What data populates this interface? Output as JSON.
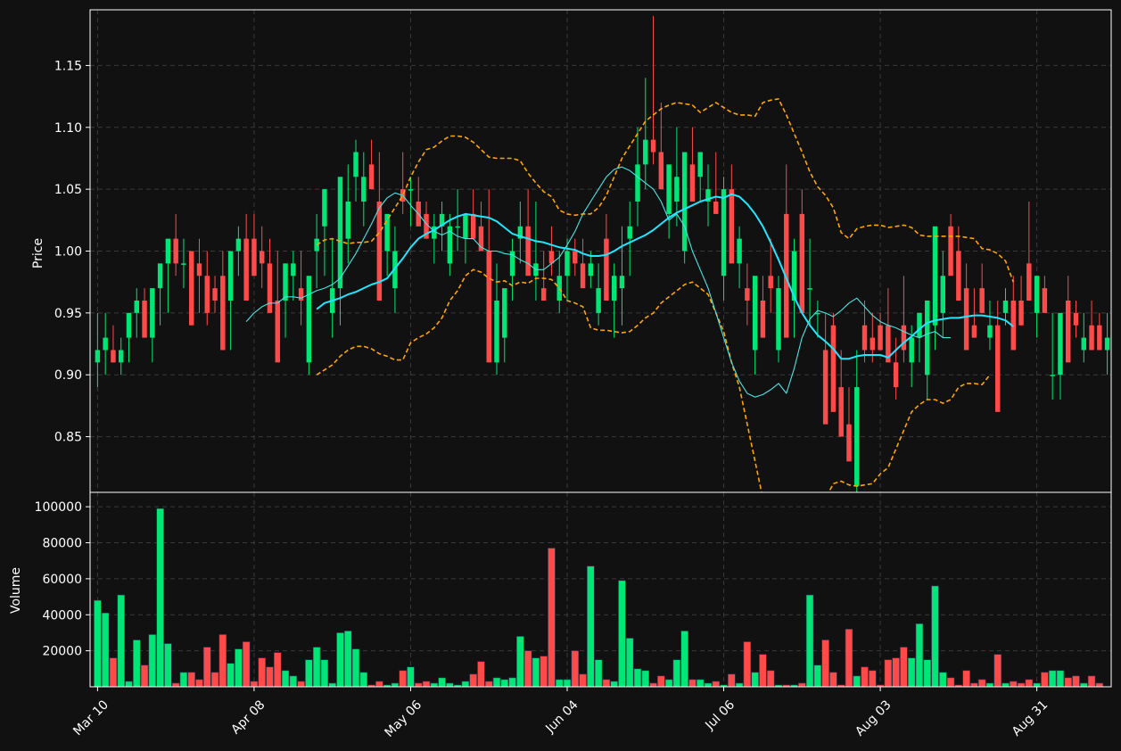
{
  "chart_data": [
    {
      "type": "candlestick",
      "title": "",
      "xlabel": "",
      "ylabel": "Price",
      "ylim": [
        0.805,
        1.195
      ],
      "y_ticks": [
        "0.85",
        "0.90",
        "0.95",
        "1.00",
        "1.05",
        "1.10",
        "1.15"
      ],
      "x_tick_labels": [
        "Mar 10",
        "Apr 08",
        "May 06",
        "Jun 04",
        "Jul 06",
        "Aug 03",
        "Aug 31"
      ],
      "x_tick_index": [
        0,
        20,
        40,
        60,
        80,
        100,
        120
      ],
      "grid": true,
      "colors": {
        "up": "#00e676",
        "down": "#ff4a4a",
        "ma_fast": "#4ce3e3",
        "ma_slow": "#22e5ff",
        "bollinger": "#ffa500",
        "grid": "#3a3a3a",
        "axis": "#ffffff",
        "background": "#111111"
      },
      "open": [
        0.91,
        0.92,
        0.92,
        0.91,
        0.93,
        0.95,
        0.96,
        0.93,
        0.97,
        0.99,
        1.01,
        0.99,
        1.0,
        0.99,
        0.98,
        0.97,
        0.98,
        0.96,
        1.0,
        1.01,
        1.01,
        1.0,
        0.99,
        0.96,
        0.96,
        0.98,
        0.97,
        0.91,
        1.0,
        1.02,
        0.95,
        0.97,
        1.01,
        1.06,
        1.04,
        1.07,
        1.04,
        1.0,
        0.97,
        1.05,
        1.05,
        1.04,
        1.03,
        1.01,
        1.02,
        0.99,
        1.02,
        1.01,
        1.03,
        1.02,
        1.0,
        0.91,
        0.93,
        0.98,
        1.01,
        1.02,
        0.98,
        0.97,
        1.0,
        0.96,
        0.98,
        1.0,
        0.99,
        0.98,
        0.95,
        1.01,
        0.96,
        0.97,
        1.01,
        1.04,
        1.07,
        1.09,
        1.08,
        1.03,
        1.04,
        1.0,
        1.07,
        1.06,
        1.04,
        1.04,
        0.98,
        1.05,
        0.99,
        0.97,
        0.92,
        0.96,
        0.98,
        0.92,
        1.03,
        0.96,
        1.03,
        0.97,
        0.95,
        0.92,
        0.94,
        0.89,
        0.86,
        0.81,
        0.94,
        0.93,
        0.94,
        0.94,
        0.91,
        0.94,
        0.91,
        0.93,
        0.9,
        0.94,
        0.95,
        1.02,
        1.0,
        0.97,
        0.94,
        0.97,
        0.93,
        0.94,
        0.95,
        0.96,
        0.96,
        0.99,
        0.95,
        0.97,
        0.9,
        0.9,
        0.96,
        0.95,
        0.92,
        0.94,
        0.94,
        0.92
      ],
      "high": [
        0.95,
        0.95,
        0.94,
        0.93,
        0.95,
        0.97,
        0.97,
        0.96,
        0.98,
        1.01,
        1.03,
        1.01,
        1.0,
        1.01,
        1.0,
        0.98,
        1.0,
        0.98,
        1.02,
        1.03,
        1.03,
        1.02,
        1.01,
        1.0,
        0.99,
        1.0,
        1.0,
        0.97,
        1.03,
        1.05,
        1.01,
        1.04,
        1.07,
        1.09,
        1.08,
        1.09,
        1.08,
        1.03,
        1.02,
        1.08,
        1.06,
        1.06,
        1.04,
        1.03,
        1.04,
        1.03,
        1.05,
        1.03,
        1.05,
        1.04,
        1.05,
        0.99,
        0.96,
        1.01,
        1.04,
        1.05,
        1.04,
        1.0,
        1.02,
        1.0,
        1.01,
        1.01,
        1.01,
        1.0,
        0.99,
        1.03,
        0.99,
        1.02,
        1.04,
        1.1,
        1.14,
        1.19,
        1.12,
        1.06,
        1.1,
        1.07,
        1.1,
        1.08,
        1.07,
        1.08,
        1.06,
        1.07,
        1.02,
        0.99,
        0.97,
        0.98,
        1.01,
        0.98,
        1.07,
        1.01,
        1.05,
        1.01,
        0.96,
        0.95,
        0.95,
        0.92,
        0.89,
        0.92,
        0.96,
        0.95,
        0.95,
        0.97,
        0.93,
        0.98,
        0.94,
        0.95,
        0.94,
        0.99,
        1.0,
        1.03,
        1.02,
        0.99,
        0.97,
        0.99,
        0.96,
        0.96,
        0.97,
        0.98,
        0.98,
        1.04,
        0.97,
        0.98,
        0.95,
        0.93,
        0.98,
        0.96,
        0.95,
        0.96,
        0.95,
        0.95
      ],
      "low": [
        0.89,
        0.9,
        0.91,
        0.9,
        0.91,
        0.93,
        0.94,
        0.91,
        0.94,
        0.95,
        0.98,
        0.97,
        0.98,
        0.95,
        0.94,
        0.95,
        0.95,
        0.92,
        0.98,
        0.99,
        0.99,
        0.97,
        0.95,
        0.94,
        0.93,
        0.96,
        0.94,
        0.9,
        0.97,
        0.98,
        0.93,
        0.94,
        0.99,
        1.04,
        1.02,
        1.05,
        1.01,
        0.98,
        0.95,
        1.03,
        1.02,
        1.02,
        1.01,
        0.99,
        1.0,
        0.98,
        1.0,
        0.99,
        1.01,
        1.0,
        0.98,
        0.9,
        0.91,
        0.96,
        0.99,
        1.0,
        0.96,
        0.96,
        0.98,
        0.95,
        0.96,
        0.98,
        0.97,
        0.97,
        0.94,
        0.99,
        0.93,
        0.94,
        0.98,
        1.02,
        1.05,
        1.07,
        1.05,
        1.01,
        1.02,
        0.99,
        1.04,
        1.04,
        1.02,
        1.03,
        0.96,
        1.03,
        0.97,
        0.94,
        0.9,
        0.93,
        0.95,
        0.91,
        1.0,
        0.93,
        1.0,
        0.94,
        0.93,
        0.91,
        0.92,
        0.86,
        0.85,
        0.8,
        0.91,
        0.91,
        0.92,
        0.92,
        0.88,
        0.91,
        0.89,
        0.91,
        0.88,
        0.92,
        0.93,
        0.99,
        0.98,
        0.95,
        0.93,
        0.95,
        0.92,
        0.92,
        0.94,
        0.94,
        0.94,
        0.96,
        0.93,
        0.95,
        0.88,
        0.88,
        0.94,
        0.93,
        0.91,
        0.92,
        0.92,
        0.9
      ],
      "close": [
        0.92,
        0.93,
        0.91,
        0.92,
        0.95,
        0.96,
        0.93,
        0.97,
        0.99,
        1.01,
        0.99,
        0.99,
        0.94,
        0.98,
        0.95,
        0.96,
        0.92,
        1.0,
        1.01,
        0.96,
        0.98,
        0.99,
        0.95,
        0.91,
        0.99,
        0.99,
        0.96,
        0.98,
        1.01,
        1.05,
        0.97,
        1.06,
        1.04,
        1.08,
        1.06,
        1.05,
        0.96,
        1.03,
        1.0,
        1.04,
        1.05,
        1.02,
        1.01,
        1.02,
        1.03,
        1.02,
        1.02,
        1.03,
        1.01,
        1.0,
        0.91,
        0.96,
        0.97,
        1.0,
        1.02,
        0.98,
        0.99,
        0.96,
        0.99,
        0.98,
        1.0,
        0.99,
        0.97,
        0.99,
        0.97,
        0.96,
        0.98,
        0.98,
        1.02,
        1.07,
        1.09,
        1.08,
        1.05,
        1.07,
        1.06,
        1.08,
        1.04,
        1.08,
        1.05,
        1.03,
        1.05,
        0.99,
        1.01,
        0.96,
        0.98,
        0.93,
        0.97,
        0.97,
        0.93,
        1.0,
        0.95,
        0.97,
        0.95,
        0.86,
        0.87,
        0.85,
        0.83,
        0.89,
        0.92,
        0.92,
        0.92,
        0.91,
        0.89,
        0.92,
        0.93,
        0.95,
        0.96,
        1.02,
        0.98,
        0.98,
        0.96,
        0.92,
        0.93,
        0.95,
        0.94,
        0.87,
        0.96,
        0.92,
        0.94,
        0.96,
        0.98,
        0.95,
        0.9,
        0.95,
        0.91,
        0.94,
        0.93,
        0.92,
        0.92,
        0.93
      ],
      "ma_fast_start": 19,
      "ma_fast": [
        0.943,
        0.95,
        0.955,
        0.958,
        0.958,
        0.963,
        0.963,
        0.962,
        0.965,
        0.968,
        0.97,
        0.973,
        0.978,
        0.988,
        0.998,
        1.01,
        1.022,
        1.035,
        1.043,
        1.047,
        1.045,
        1.037,
        1.03,
        1.022,
        1.016,
        1.013,
        1.016,
        1.012,
        1.01,
        1.01,
        1.003,
        1.0,
        1.0,
        0.998,
        0.997,
        0.993,
        0.99,
        0.985,
        0.985,
        0.99,
        0.995,
        1.005,
        1.016,
        1.03,
        1.04,
        1.05,
        1.06,
        1.066,
        1.068,
        1.065,
        1.06,
        1.055,
        1.05,
        1.04,
        1.025,
        1.03,
        1.02,
        1.0,
        0.985,
        0.97,
        0.95,
        0.93,
        0.91,
        0.895,
        0.885,
        0.882,
        0.884,
        0.888,
        0.893,
        0.885,
        0.905,
        0.93,
        0.945,
        0.952,
        0.95,
        0.947,
        0.952,
        0.958,
        0.962,
        0.955,
        0.948,
        0.943,
        0.94,
        0.938,
        0.935,
        0.932,
        0.93,
        0.933,
        0.935,
        0.93,
        0.93
      ],
      "ma_slow_start": 28,
      "ma_slow": [
        0.953,
        0.958,
        0.96,
        0.962,
        0.965,
        0.967,
        0.97,
        0.973,
        0.975,
        0.978,
        0.986,
        0.994,
        1.003,
        1.01,
        1.014,
        1.017,
        1.021,
        1.025,
        1.028,
        1.03,
        1.029,
        1.028,
        1.027,
        1.024,
        1.019,
        1.014,
        1.012,
        1.01,
        1.008,
        1.007,
        1.005,
        1.003,
        1.002,
        1.001,
        0.998,
        0.996,
        0.996,
        0.997,
        1.0,
        1.004,
        1.007,
        1.01,
        1.013,
        1.017,
        1.022,
        1.027,
        1.031,
        1.034,
        1.037,
        1.04,
        1.042,
        1.044,
        1.043,
        1.046,
        1.044,
        1.038,
        1.03,
        1.02,
        1.007,
        0.993,
        0.978,
        0.963,
        0.95,
        0.94,
        0.932,
        0.927,
        0.921,
        0.913,
        0.913,
        0.915,
        0.916,
        0.916,
        0.916,
        0.914,
        0.92,
        0.926,
        0.931,
        0.937,
        0.942,
        0.944,
        0.945,
        0.946,
        0.946,
        0.947,
        0.948,
        0.948,
        0.947,
        0.946,
        0.944,
        0.939
      ],
      "bb_upper_start": 28,
      "bb_upper": [
        1.005,
        1.009,
        1.01,
        1.008,
        1.006,
        1.007,
        1.007,
        1.008,
        1.015,
        1.025,
        1.035,
        1.045,
        1.06,
        1.072,
        1.082,
        1.084,
        1.089,
        1.093,
        1.093,
        1.092,
        1.088,
        1.082,
        1.076,
        1.075,
        1.075,
        1.075,
        1.073,
        1.063,
        1.055,
        1.048,
        1.044,
        1.033,
        1.03,
        1.029,
        1.03,
        1.03,
        1.035,
        1.045,
        1.06,
        1.075,
        1.085,
        1.095,
        1.105,
        1.11,
        1.115,
        1.118,
        1.12,
        1.119,
        1.118,
        1.112,
        1.116,
        1.12,
        1.116,
        1.112,
        1.11,
        1.11,
        1.109,
        1.12,
        1.122,
        1.123,
        1.11,
        1.095,
        1.08,
        1.064,
        1.052,
        1.045,
        1.035,
        1.015,
        1.01,
        1.018,
        1.02,
        1.021,
        1.021,
        1.019,
        1.02,
        1.021,
        1.019,
        1.013,
        1.012,
        1.012,
        1.012,
        1.012,
        1.012,
        1.011,
        1.01,
        1.002,
        1.001,
        0.998,
        0.992,
        0.975
      ],
      "bb_lower_start": 28,
      "bb_lower": [
        0.9,
        0.904,
        0.908,
        0.915,
        0.92,
        0.923,
        0.923,
        0.921,
        0.917,
        0.915,
        0.912,
        0.912,
        0.926,
        0.93,
        0.933,
        0.938,
        0.946,
        0.96,
        0.968,
        0.98,
        0.985,
        0.983,
        0.978,
        0.975,
        0.976,
        0.972,
        0.975,
        0.974,
        0.978,
        0.978,
        0.977,
        0.97,
        0.96,
        0.958,
        0.955,
        0.938,
        0.936,
        0.936,
        0.935,
        0.934,
        0.935,
        0.94,
        0.946,
        0.95,
        0.958,
        0.963,
        0.968,
        0.973,
        0.975,
        0.97,
        0.965,
        0.95,
        0.935,
        0.91,
        0.89,
        0.86,
        0.83,
        0.8,
        0.77,
        0.745,
        0.745,
        0.745,
        0.752,
        0.76,
        0.78,
        0.8,
        0.812,
        0.814,
        0.811,
        0.81,
        0.811,
        0.812,
        0.82,
        0.825,
        0.84,
        0.855,
        0.87,
        0.876,
        0.88,
        0.88,
        0.877,
        0.88,
        0.89,
        0.893,
        0.893,
        0.892,
        0.9
      ]
    },
    {
      "type": "bar",
      "title": "",
      "xlabel": "",
      "ylabel": "Volume",
      "ylim": [
        0,
        108000
      ],
      "y_ticks": [
        "20000",
        "40000",
        "60000",
        "80000",
        "100000"
      ],
      "grid": true,
      "values": [
        48000,
        41000,
        16000,
        51000,
        3000,
        26000,
        12000,
        29000,
        99000,
        24000,
        2000,
        8000,
        8000,
        4000,
        22000,
        8000,
        29000,
        13000,
        21000,
        25000,
        3000,
        16000,
        11000,
        19000,
        9000,
        6000,
        3000,
        15000,
        22000,
        15000,
        2000,
        30000,
        31000,
        21000,
        8000,
        1000,
        3000,
        1000,
        2000,
        9000,
        11000,
        2000,
        3000,
        2000,
        5000,
        2000,
        1000,
        3000,
        7000,
        14000,
        3000,
        5000,
        4000,
        5000,
        28000,
        20000,
        16000,
        17000,
        77000,
        4000,
        4000,
        20000,
        7000,
        67000,
        15000,
        4000,
        3000,
        59000,
        27000,
        10000,
        9000,
        2000,
        6000,
        4000,
        15000,
        31000,
        4000,
        4000,
        2000,
        3000,
        1000,
        7000,
        2000,
        25000,
        8000,
        18000,
        9000,
        1000,
        1000,
        1000,
        2000,
        51000,
        12000,
        26000,
        8000,
        1000,
        32000,
        6000,
        11000,
        9000,
        1000,
        15000,
        16000,
        22000,
        16000,
        35000,
        15000,
        56000,
        8000,
        5000,
        1000,
        9000,
        2000,
        4000,
        2000,
        18000,
        2000,
        3000,
        2000,
        4000,
        2000,
        8000,
        9000,
        9000,
        5000,
        6000,
        2000,
        6000,
        2000
      ]
    }
  ]
}
